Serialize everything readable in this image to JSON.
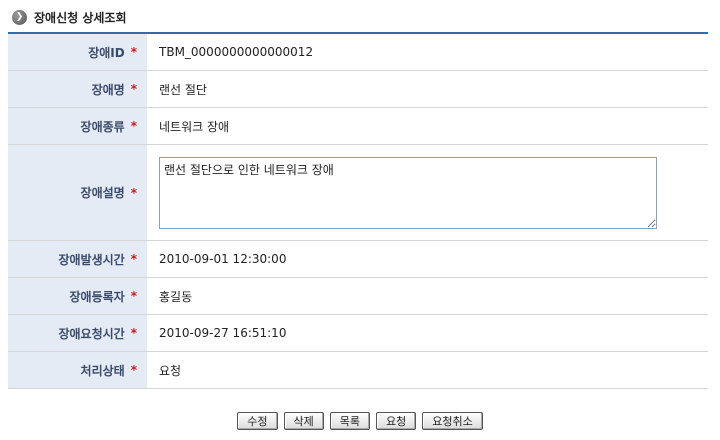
{
  "page": {
    "title": "장애신청 상세조회"
  },
  "fields": [
    {
      "label": "장애ID",
      "required_mark": "*",
      "value": "TBM_0000000000000012"
    },
    {
      "label": "장애명",
      "required_mark": "*",
      "value": "랜선 절단"
    },
    {
      "label": "장애종류",
      "required_mark": "*",
      "value": "네트워크 장애"
    },
    {
      "label": "장애설명",
      "required_mark": "*",
      "value": "랜선 절단으로 인한 네트워크 장애"
    },
    {
      "label": "장애발생시간",
      "required_mark": "*",
      "value": "2010-09-01 12:30:00"
    },
    {
      "label": "장애등록자",
      "required_mark": "*",
      "value": "홍길동"
    },
    {
      "label": "장애요청시간",
      "required_mark": "*",
      "value": "2010-09-27 16:51:10"
    },
    {
      "label": "처리상태",
      "required_mark": "*",
      "value": "요청"
    }
  ],
  "buttons": {
    "edit": "수정",
    "delete": "삭제",
    "list": "목록",
    "request": "요청",
    "cancel_request": "요청취소"
  },
  "colors": {
    "header_line": "#2f6bb0",
    "label_bg": "#e4ebf5",
    "required": "#d21414"
  },
  "icons": {
    "title": "circle-chevron-right-icon"
  }
}
